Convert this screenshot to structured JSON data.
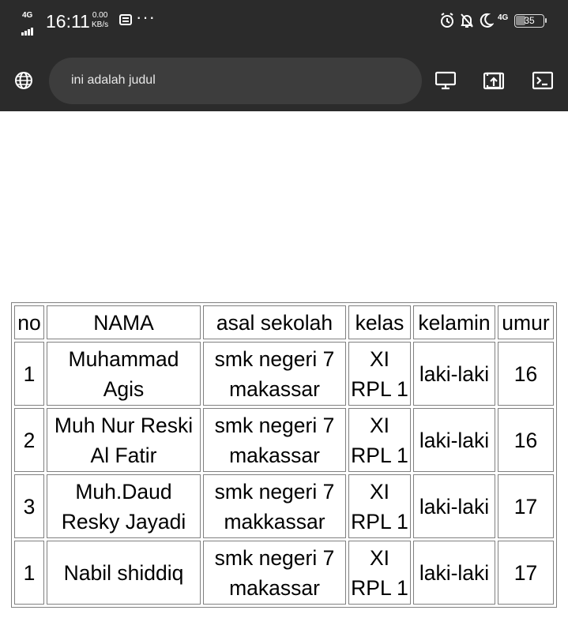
{
  "status_bar": {
    "network_left": "4G",
    "time": "16:11",
    "speed_value": "0.00",
    "speed_unit": "KB/s",
    "more": "···",
    "network_right": "4G",
    "battery": "35",
    "icons": [
      "signal-icon",
      "screenshot-icon",
      "alarm-icon",
      "silent-bell-icon",
      "moon-icon",
      "battery-icon"
    ]
  },
  "browser": {
    "url_text": "ini adalah judul",
    "icons": [
      "globe-icon",
      "desktop-icon",
      "share-icon",
      "terminal-icon"
    ]
  },
  "table": {
    "headers": [
      "no",
      "NAMA",
      "asal sekolah",
      "kelas",
      "kelamin",
      "umur"
    ],
    "rows": [
      {
        "no": "1",
        "nama": [
          "Muhammad",
          "Agis"
        ],
        "sekolah": [
          "smk negeri 7",
          "makassar"
        ],
        "kelas": [
          "XI",
          "RPL 1"
        ],
        "kelamin": "laki-laki",
        "umur": "16"
      },
      {
        "no": "2",
        "nama": [
          "Muh Nur Reski",
          "Al Fatir"
        ],
        "sekolah": [
          "smk negeri 7",
          "makassar"
        ],
        "kelas": [
          "XI",
          "RPL 1"
        ],
        "kelamin": "laki-laki",
        "umur": "16"
      },
      {
        "no": "3",
        "nama": [
          "Muh.Daud",
          "Resky Jayadi"
        ],
        "sekolah": [
          "smk negeri 7",
          "makkassar"
        ],
        "kelas": [
          "XI",
          "RPL 1"
        ],
        "kelamin": "laki-laki",
        "umur": "17"
      },
      {
        "no": "1",
        "nama": [
          "Nabil shiddiq"
        ],
        "sekolah": [
          "smk negeri 7",
          "makassar"
        ],
        "kelas": [
          "XI",
          "RPL 1"
        ],
        "kelamin": "laki-laki",
        "umur": "17"
      }
    ]
  }
}
